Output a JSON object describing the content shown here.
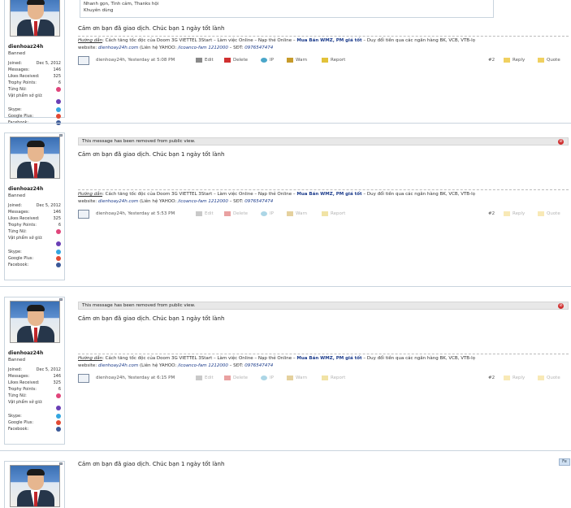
{
  "quote_box": {
    "lines": [
      "Nhanh gọn, Tình cảm, Thanks hội",
      "Khuyên dùng"
    ]
  },
  "user": {
    "name": "dienhoaz24h",
    "title": "Banned",
    "stats": [
      {
        "label": "Joined:",
        "value": "Dec 5, 2012"
      },
      {
        "label": "Messages:",
        "value": "146"
      },
      {
        "label": "Likes Received:",
        "value": "325"
      },
      {
        "label": "Trophy Points:",
        "value": "6"
      },
      {
        "label": "Từng Nữ:",
        "value": ""
      },
      {
        "label": "Vật phẩm sở giữ:",
        "value": ""
      },
      {
        "label": "Skype:",
        "value": ""
      },
      {
        "label": "Google Plus:",
        "value": ""
      },
      {
        "label": "Facebook:",
        "value": ""
      }
    ]
  },
  "posts": [
    {
      "removed_notice": "",
      "message": "Cảm ơn bạn đã giao dịch. Chúc bạn 1 ngày tốt lành",
      "footer_by": "dienhoay24h, Yesterday at 5:08 PM",
      "post_number": "#2"
    },
    {
      "removed_notice": "This message has been removed from public view.",
      "message": "Cảm ơn bạn đã giao dịch. Chúc bạn 1 ngày tốt lành",
      "footer_by": "dienhoay24h, Yesterday at 5:53 PM",
      "post_number": "#2"
    },
    {
      "removed_notice": "This message has been removed from public view.",
      "message": "Cảm ơn bạn đã giao dịch. Chúc bạn 1 ngày tốt lành",
      "footer_by": "dienhoay24h, Yesterday at 6:15 PM",
      "post_number": "#2"
    },
    {
      "removed_notice": "",
      "message": "Cảm ơn bạn đã giao dịch. Chúc bạn 1 ngày tốt lành",
      "footer_by": "",
      "post_number": ""
    }
  ],
  "signature": {
    "label": "Hướng dẫn",
    "text1": ": Cách tăng tốc độc của Doom 3G VIETTEL 3Start – Làm việc Online – Nạp thẻ Online – ",
    "bold": "Mua Bán WMZ, PM giá tốt",
    "text2": " – Duy đổi tiền qua các ngân hàng BK, VCB, VTB-lọ",
    "line2_pre": "website: ",
    "link1": "dienhoay24h.com",
    "line2_mid": " (Liên hệ YAHOO: ",
    "link2": "/icoanco-fam 1212000",
    "line2_post": " – SĐT: ",
    "phone": "0976547474"
  },
  "actions": {
    "edit": "Edit",
    "delete": "Delete",
    "ip": "IP",
    "warn": "Warn",
    "report": "Report",
    "reply": "Reply",
    "quote": "Quote"
  },
  "feedback_button": "Fe",
  "colors": {
    "accent": "#1a3a8a",
    "separator": "#c9d4de",
    "notice_bg": "#e8e8e8",
    "warning_red": "#d03030"
  }
}
